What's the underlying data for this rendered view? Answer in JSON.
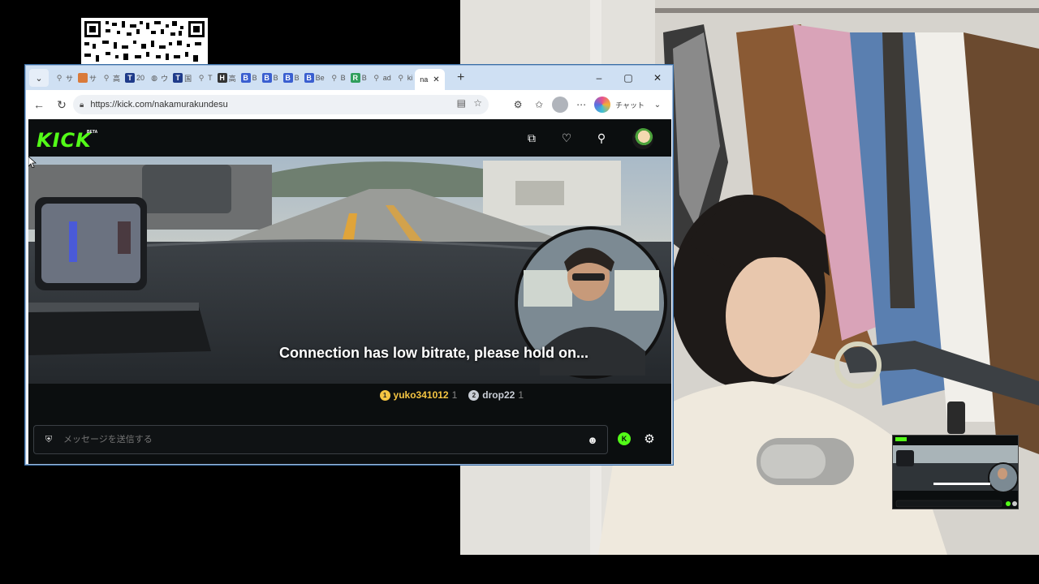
{
  "browser": {
    "tabs": [
      {
        "icon": "search-icon",
        "label": "サ"
      },
      {
        "icon": "orange-favicon",
        "label": "サ"
      },
      {
        "icon": "search-icon",
        "label": "高"
      },
      {
        "icon": "T",
        "label": "20"
      },
      {
        "icon": "globe-icon",
        "label": "ウ"
      },
      {
        "icon": "T",
        "label": "国"
      },
      {
        "icon": "search-icon",
        "label": "T"
      },
      {
        "icon": "H",
        "label": "高"
      },
      {
        "icon": "B",
        "label": "B"
      },
      {
        "icon": "B",
        "label": "B"
      },
      {
        "icon": "B",
        "label": "B"
      },
      {
        "icon": "B",
        "label": "Be"
      },
      {
        "icon": "search-icon",
        "label": "B"
      },
      {
        "icon": "R",
        "label": "B"
      },
      {
        "icon": "search-icon",
        "label": "ad"
      },
      {
        "icon": "search-icon",
        "label": "ki"
      }
    ],
    "active_tab": {
      "label": "na",
      "close": "✕"
    },
    "new_tab": "+",
    "window_controls": {
      "minimize": "–",
      "maximize": "▢",
      "close": "✕"
    },
    "url": "https://kick.com/nakamurakundesu",
    "copilot_label": "チャット"
  },
  "kick": {
    "logo": "KICK",
    "beta": "BETA",
    "buffering_message": "Connection has low bitrate, please hold on...",
    "gifters": [
      {
        "rank": "1",
        "name": "yuko341012",
        "count": "1",
        "color": "#f5c542"
      },
      {
        "rank": "2",
        "name": "drop22",
        "count": "1",
        "color": "#c9ced6"
      }
    ],
    "chat": {
      "placeholder": "メッセージを送信する"
    },
    "colors": {
      "brand": "#53fc18",
      "background": "#0b0e0f"
    }
  }
}
